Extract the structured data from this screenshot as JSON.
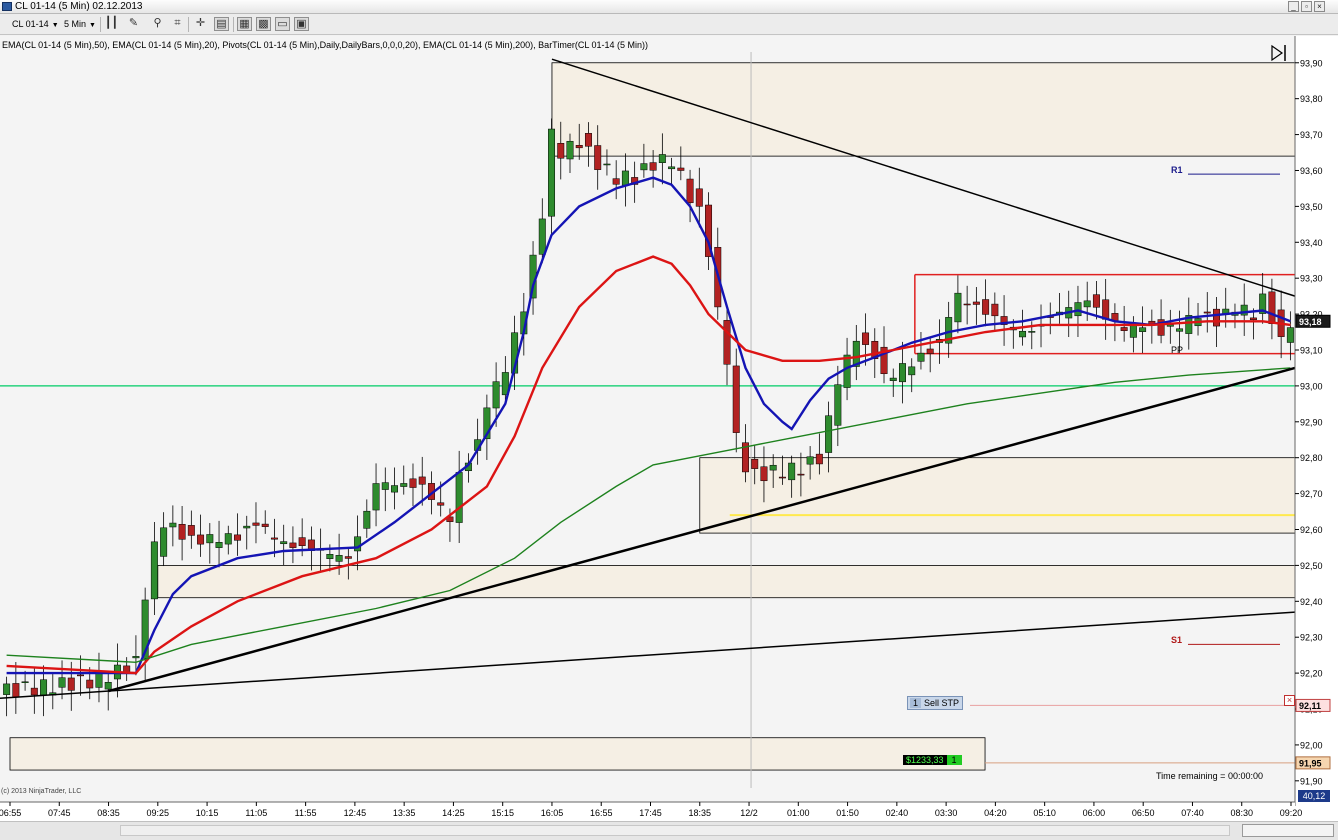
{
  "window": {
    "title": "CL 01-14 (5 Min)  02.12.2013",
    "buttons": {
      "minimize": "_",
      "restore": "▫",
      "close": "×",
      "minimize2": "_",
      "restore2": "▫",
      "close2": "×"
    }
  },
  "toolbar": {
    "instrument": "CL 01-14",
    "interval": "5 Min"
  },
  "indicator_label": "EMA(CL 01-14 (5 Min),50), EMA(CL 01-14 (5 Min),20), Pivots(CL 01-14 (5 Min),Daily,DailyBars,0,0,0,20), EMA(CL 01-14 (5 Min),200), BarTimer(CL 01-14 (5 Min))",
  "pivots": {
    "r1": "R1",
    "pp": "PP",
    "s1": "S1"
  },
  "order": {
    "qty": "1",
    "label": "Sell STP",
    "price": "92,11"
  },
  "position": {
    "pnl": "$1233,33",
    "qty": "1",
    "price": "91,95"
  },
  "current_price": "93,18",
  "timer": "Time remaining = 00:00:00",
  "copyright": "(c) 2013 NinjaTrader, LLC",
  "scroll_value": "40,12",
  "colors": {
    "bg": "#f4f4f4",
    "up": "#2e8b2e",
    "down": "#b22222",
    "ema20": "#1414b4",
    "ema50": "#dc1414",
    "ema200": "#1e821e",
    "hline": "#00cc66",
    "zone": "#f5efe4"
  },
  "chart_data": {
    "type": "candlestick",
    "title": "",
    "xlabel": "",
    "ylabel": "",
    "ylim": [
      91.88,
      93.93
    ],
    "y_ticks": [
      "93,90",
      "93,80",
      "93,70",
      "93,60",
      "93,50",
      "93,40",
      "93,30",
      "93,20",
      "93,10",
      "93,00",
      "92,90",
      "92,80",
      "92,70",
      "92,60",
      "92,50",
      "92,40",
      "92,30",
      "92,20",
      "92,10",
      "92,00",
      "91,90"
    ],
    "x_ticks": [
      "06:55",
      "07:45",
      "08:35",
      "09:25",
      "10:15",
      "11:05",
      "11:55",
      "12:45",
      "13:35",
      "14:25",
      "15:15",
      "16:05",
      "16:55",
      "17:45",
      "18:35",
      "12/2",
      "01:00",
      "01:50",
      "02:40",
      "03:30",
      "04:20",
      "05:10",
      "06:00",
      "06:50",
      "07:40",
      "08:30",
      "09:20"
    ],
    "levels": {
      "r1": 93.59,
      "pp": 93.09,
      "s1": 92.28,
      "sell_stop": 92.11,
      "position": 91.95,
      "current": 93.18,
      "hline": 93.0
    },
    "close_path": [
      [
        0,
        92.15
      ],
      [
        10,
        92.18
      ],
      [
        14,
        92.23
      ],
      [
        15,
        92.42
      ],
      [
        16,
        92.55
      ],
      [
        17,
        92.62
      ],
      [
        20,
        92.57
      ],
      [
        25,
        92.58
      ],
      [
        27,
        92.62
      ],
      [
        30,
        92.56
      ],
      [
        34,
        92.54
      ],
      [
        37,
        92.52
      ],
      [
        38,
        92.58
      ],
      [
        39,
        92.65
      ],
      [
        40,
        92.73
      ],
      [
        45,
        92.72
      ],
      [
        48,
        92.63
      ],
      [
        49,
        92.75
      ],
      [
        51,
        92.84
      ],
      [
        52,
        92.95
      ],
      [
        54,
        93.05
      ],
      [
        56,
        93.22
      ],
      [
        58,
        93.48
      ],
      [
        59,
        93.7
      ],
      [
        60,
        93.65
      ],
      [
        62,
        93.68
      ],
      [
        64,
        93.62
      ],
      [
        66,
        93.58
      ],
      [
        68,
        93.58
      ],
      [
        70,
        93.62
      ],
      [
        72,
        93.63
      ],
      [
        73,
        93.58
      ],
      [
        75,
        93.48
      ],
      [
        76,
        93.38
      ],
      [
        77,
        93.2
      ],
      [
        78,
        93.08
      ],
      [
        79,
        92.85
      ],
      [
        80,
        92.78
      ],
      [
        81,
        92.75
      ],
      [
        83,
        92.76
      ],
      [
        86,
        92.77
      ],
      [
        88,
        92.8
      ],
      [
        89,
        92.9
      ],
      [
        90,
        93.02
      ],
      [
        91,
        93.07
      ],
      [
        92,
        93.14
      ],
      [
        93,
        93.1
      ],
      [
        94,
        93.09
      ],
      [
        95,
        93.02
      ],
      [
        97,
        93.05
      ],
      [
        99,
        93.08
      ],
      [
        101,
        93.12
      ],
      [
        102,
        93.2
      ],
      [
        103,
        93.25
      ],
      [
        105,
        93.22
      ],
      [
        107,
        93.19
      ],
      [
        109,
        93.16
      ],
      [
        111,
        93.15
      ],
      [
        113,
        93.19
      ],
      [
        115,
        93.22
      ],
      [
        117,
        93.24
      ],
      [
        119,
        93.19
      ],
      [
        121,
        93.16
      ],
      [
        123,
        93.17
      ],
      [
        125,
        93.15
      ],
      [
        127,
        93.17
      ],
      [
        129,
        93.2
      ],
      [
        131,
        93.18
      ],
      [
        133,
        93.22
      ],
      [
        135,
        93.2
      ],
      [
        136,
        93.24
      ],
      [
        137,
        93.19
      ],
      [
        138,
        93.12
      ],
      [
        139,
        93.18
      ]
    ],
    "series": [
      {
        "name": "EMA(CL 01-14 (5 Min),20)",
        "path": [
          [
            0,
            92.2
          ],
          [
            14,
            92.2
          ],
          [
            16,
            92.32
          ],
          [
            18,
            92.42
          ],
          [
            20,
            92.47
          ],
          [
            25,
            92.52
          ],
          [
            30,
            92.54
          ],
          [
            38,
            92.55
          ],
          [
            42,
            92.62
          ],
          [
            46,
            92.7
          ],
          [
            50,
            92.78
          ],
          [
            54,
            92.95
          ],
          [
            56,
            93.15
          ],
          [
            57,
            93.28
          ],
          [
            59,
            93.42
          ],
          [
            62,
            93.5
          ],
          [
            66,
            93.55
          ],
          [
            70,
            93.58
          ],
          [
            72,
            93.56
          ],
          [
            74,
            93.5
          ],
          [
            76,
            93.4
          ],
          [
            78,
            93.22
          ],
          [
            80,
            93.05
          ],
          [
            82,
            92.95
          ],
          [
            84,
            92.9
          ],
          [
            85,
            92.88
          ],
          [
            87,
            92.96
          ],
          [
            89,
            93.02
          ],
          [
            91,
            93.05
          ],
          [
            94,
            93.08
          ],
          [
            98,
            93.12
          ],
          [
            102,
            93.15
          ],
          [
            106,
            93.17
          ],
          [
            110,
            93.18
          ],
          [
            114,
            93.2
          ],
          [
            116,
            93.21
          ],
          [
            120,
            93.18
          ],
          [
            124,
            93.17
          ],
          [
            128,
            93.19
          ],
          [
            132,
            93.2
          ],
          [
            136,
            93.21
          ],
          [
            139,
            93.18
          ]
        ]
      },
      {
        "name": "EMA(CL 01-14 (5 Min),50)",
        "path": [
          [
            0,
            92.22
          ],
          [
            14,
            92.2
          ],
          [
            16,
            92.26
          ],
          [
            20,
            92.33
          ],
          [
            25,
            92.4
          ],
          [
            32,
            92.47
          ],
          [
            40,
            92.52
          ],
          [
            46,
            92.6
          ],
          [
            52,
            92.72
          ],
          [
            55,
            92.86
          ],
          [
            58,
            93.05
          ],
          [
            62,
            93.22
          ],
          [
            66,
            93.32
          ],
          [
            70,
            93.36
          ],
          [
            72,
            93.34
          ],
          [
            74,
            93.28
          ],
          [
            76,
            93.2
          ],
          [
            80,
            93.1
          ],
          [
            84,
            93.07
          ],
          [
            88,
            93.07
          ],
          [
            92,
            93.08
          ],
          [
            96,
            93.1
          ],
          [
            100,
            93.12
          ],
          [
            106,
            93.15
          ],
          [
            112,
            93.17
          ],
          [
            118,
            93.17
          ],
          [
            124,
            93.17
          ],
          [
            130,
            93.18
          ],
          [
            136,
            93.18
          ],
          [
            139,
            93.17
          ]
        ]
      },
      {
        "name": "EMA(CL 01-14 (5 Min),200)",
        "path": [
          [
            0,
            92.25
          ],
          [
            14,
            92.23
          ],
          [
            20,
            92.28
          ],
          [
            30,
            92.33
          ],
          [
            40,
            92.38
          ],
          [
            48,
            92.43
          ],
          [
            55,
            92.52
          ],
          [
            60,
            92.62
          ],
          [
            66,
            92.72
          ],
          [
            70,
            92.78
          ],
          [
            74,
            92.8
          ],
          [
            80,
            92.83
          ],
          [
            88,
            92.87
          ],
          [
            96,
            92.91
          ],
          [
            104,
            92.95
          ],
          [
            112,
            92.98
          ],
          [
            120,
            93.01
          ],
          [
            128,
            93.03
          ],
          [
            139,
            93.05
          ]
        ]
      }
    ],
    "trendlines": [
      {
        "from": [
          "06:55",
          92.13
        ],
        "to": [
          "09:20",
          92.37
        ],
        "weight": "thin"
      },
      {
        "from": [
          "08:35",
          92.15
        ],
        "to": [
          "09:20",
          93.05
        ],
        "weight": "thick"
      },
      {
        "from": [
          "16:05",
          93.91
        ],
        "to": [
          "09:20",
          93.25
        ],
        "weight": "thin"
      }
    ],
    "zones": [
      {
        "y1": 93.64,
        "y2": 93.9,
        "from": "16:05"
      },
      {
        "y1": 92.59,
        "y2": 92.8,
        "from": "18:35"
      },
      {
        "y1": 92.41,
        "y2": 92.5,
        "from": "09:25"
      },
      {
        "y1": 91.93,
        "y2": 92.02,
        "from": "06:55",
        "to": "12/2"
      }
    ],
    "range_box": {
      "y1": 93.09,
      "y2": 93.31,
      "from": "02:40"
    },
    "yellow_line": 92.64
  }
}
